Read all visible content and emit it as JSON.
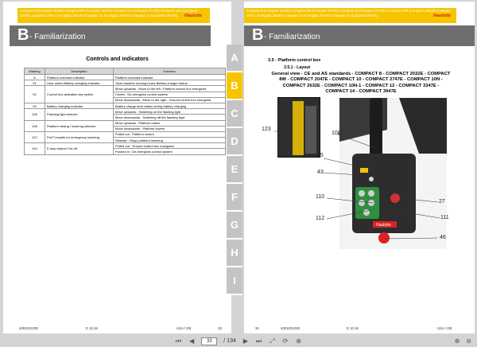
{
  "header_text": "Compact 8 (Compact 2032E) Compact 8W (Compact 2047E) Compact 10 (Compact 2747E) Compact 10N (Compact 2632E) Compact 10N-1 (Compact 2632E) Compact 12 (Compact 3347E) Compact 14 (Compact 3947E)",
  "brand": "Haulotte",
  "chapter_letter": "B",
  "chapter_label": "- Familiarization",
  "left": {
    "title": "Controls and indicators",
    "columns": [
      "Marking",
      "Description",
      "Function"
    ],
    "rows": [
      {
        "marking": "8",
        "description": "Platform overload indicator",
        "functions": [
          "Platform overload indicator"
        ]
      },
      {
        "marking": "91",
        "description": "Hour meter-Battery charging indicator",
        "functions": [
          "Total machine running hours-Battery charger status"
        ]
      },
      {
        "marking": "92",
        "description": "Control box activation key switch",
        "functions": [
          "Move upwards : Move to the left : Platform control box energized",
          "Center : De-energizes control system",
          "Move downwards : Move to the right : Ground control box energized"
        ]
      },
      {
        "marking": "93",
        "description": "Battery charging indicator",
        "functions": [
          "Battery charge level status during battery charging"
        ]
      },
      {
        "marking": "105",
        "description": "Flashing light selector",
        "functions": [
          "Move upwards : Switching on the flashing light",
          "Move downwards : Switching off the flashing light"
        ]
      },
      {
        "marking": "106",
        "description": "Platform raising / lowering selector",
        "functions": [
          "Move upwards : Platform raises",
          "Move downwards : Platform lowers"
        ]
      },
      {
        "marking": "107",
        "description": "Pull T-handle for emergency lowering",
        "functions": [
          "Pulled out : Platform lowers",
          "Release : Stops platform lowering"
        ]
      },
      {
        "marking": "144",
        "description": "E-stop button+Cut-off",
        "functions": [
          "Pulled out : Ground control box energized",
          "Pushed in : De-energizes control system"
        ]
      }
    ],
    "footer": {
      "doc": "4001001030",
      "edition": "E 10.18",
      "lang": "USA / GB",
      "page": "33"
    }
  },
  "tabs": [
    "A",
    "B",
    "C",
    "D",
    "E",
    "F",
    "G",
    "H",
    "I"
  ],
  "right": {
    "section": "3.5 -  Platform control box",
    "subsection": "3.5.1 - Layout",
    "description": "General view - CE and AS standards - COMPACT 8 - COMPACT 2032E - COMPACT 8W - COMPACT 2047E - COMPACT 10 - COMPACT 2747E - COMPACT 10N - COMPACT 2632E - COMPACT 10N-1 - COMPACT 12 - COMPACT 3347E - COMPACT 14 - COMPACT 3947E",
    "callouts": [
      "123",
      "108",
      "85",
      "43",
      "110",
      "112",
      "27",
      "111",
      "46"
    ],
    "box_label": "Haulotte",
    "footer": {
      "page": "34",
      "doc": "4001001030",
      "edition": "E 10.18",
      "lang": "USA / GB"
    }
  },
  "toolbar": {
    "current_page": "33",
    "total": "/ 134"
  }
}
